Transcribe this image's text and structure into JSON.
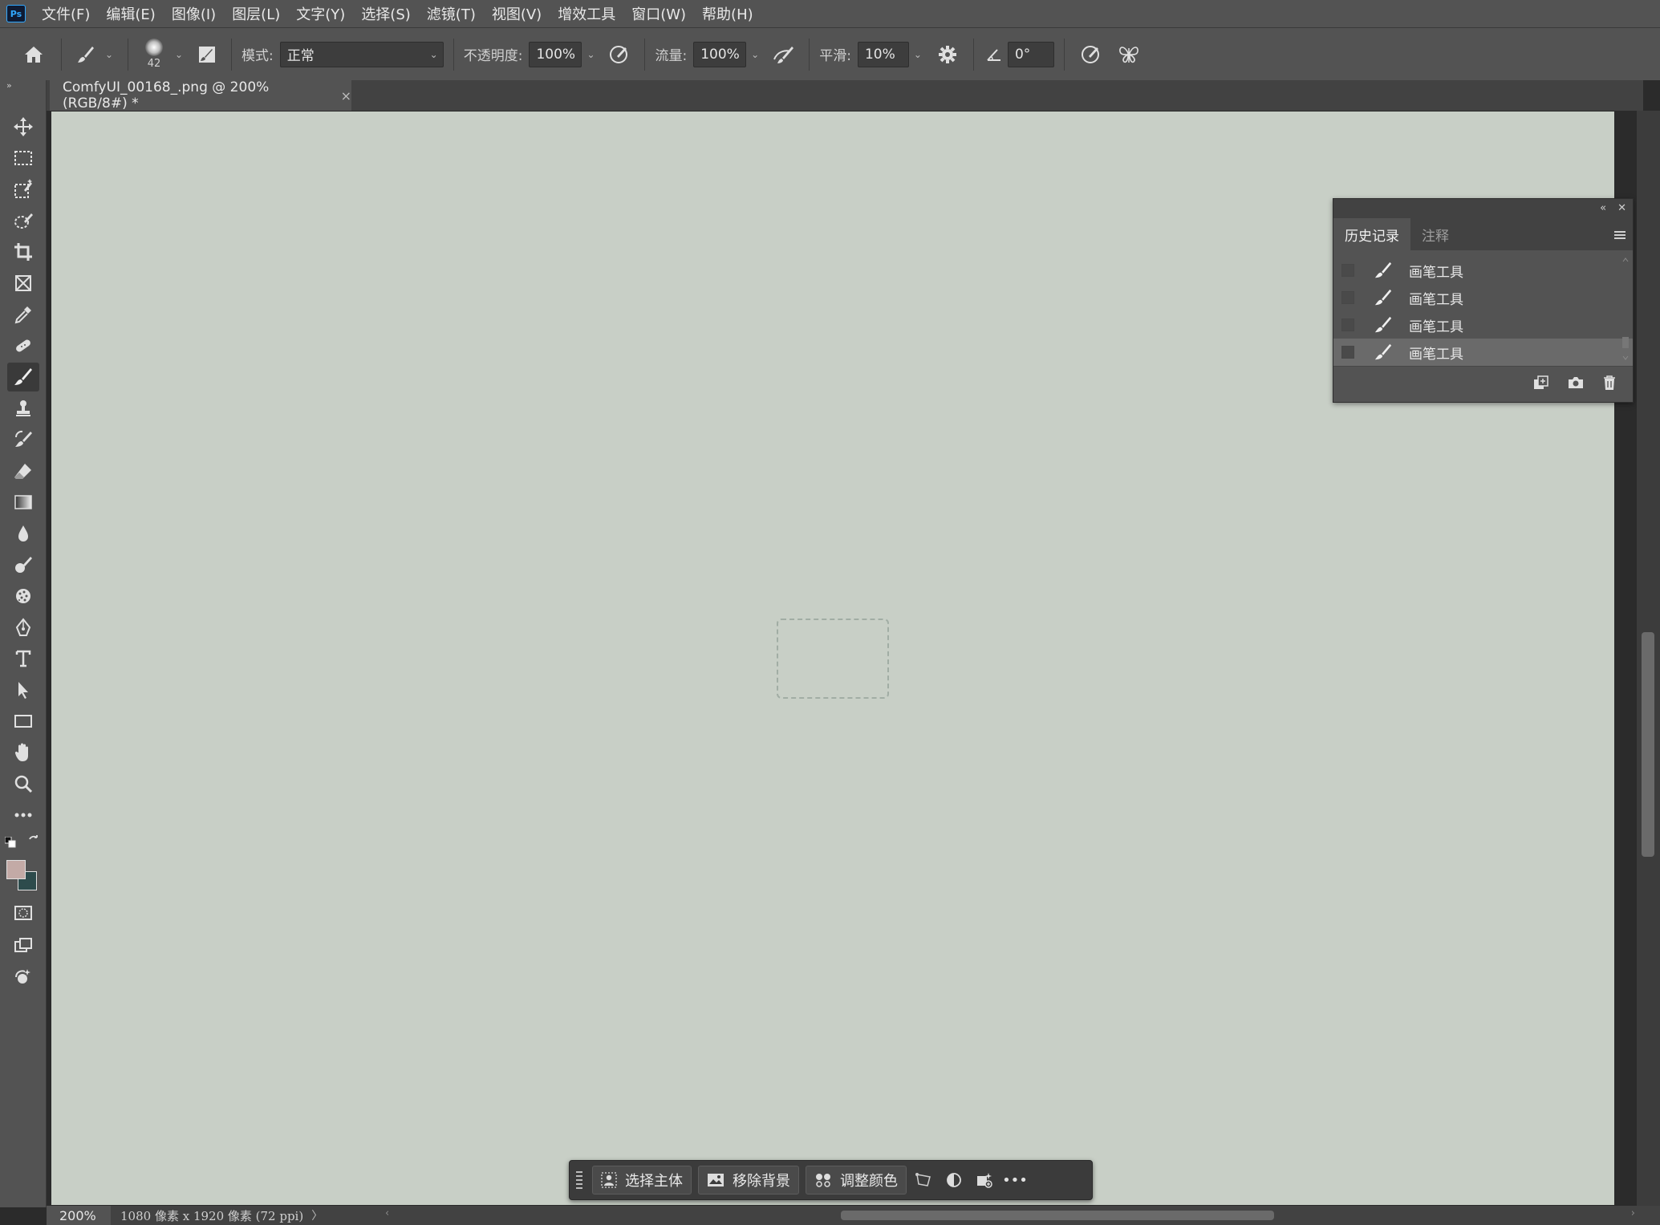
{
  "app": {
    "logo": "Ps"
  },
  "menu": [
    "文件(F)",
    "编辑(E)",
    "图像(I)",
    "图层(L)",
    "文字(Y)",
    "选择(S)",
    "滤镜(T)",
    "视图(V)",
    "增效工具",
    "窗口(W)",
    "帮助(H)"
  ],
  "options": {
    "brush_size": "42",
    "mode_label": "模式:",
    "mode_value": "正常",
    "opacity_label": "不透明度:",
    "opacity_value": "100%",
    "flow_label": "流量:",
    "flow_value": "100%",
    "smooth_label": "平滑:",
    "smooth_value": "10%",
    "angle_value": "0°"
  },
  "tools": [
    "move-tool",
    "marquee-tool",
    "object-selection-tool",
    "quick-selection-tool",
    "crop-tool",
    "frame-tool",
    "eyedropper-tool",
    "healing-brush-tool",
    "brush-tool",
    "clone-stamp-tool",
    "history-brush-tool",
    "eraser-tool",
    "gradient-tool",
    "blur-tool",
    "dodge-tool",
    "sponge-tool",
    "pen-tool",
    "type-tool",
    "path-selection-tool",
    "rectangle-tool",
    "hand-tool",
    "zoom-tool",
    "edit-toolbar"
  ],
  "colors": {
    "foreground": "#c3aaa6",
    "background": "#2d4b4c"
  },
  "document": {
    "tab_title": "ComfyUI_00168_.png @ 200%(RGB/8#) *",
    "close": "×"
  },
  "history_panel": {
    "tabs": [
      "历史记录",
      "注释"
    ],
    "items": [
      "画笔工具",
      "画笔工具",
      "画笔工具",
      "画笔工具"
    ],
    "selected_index": 3
  },
  "taskbar": {
    "select_subject": "选择主体",
    "remove_background": "移除背景",
    "adjust_color": "调整颜色",
    "more": "•••"
  },
  "status": {
    "zoom": "200%",
    "doc_info": "1080 像素 x 1920 像素 (72 ppi)",
    "arrow": "〉"
  }
}
